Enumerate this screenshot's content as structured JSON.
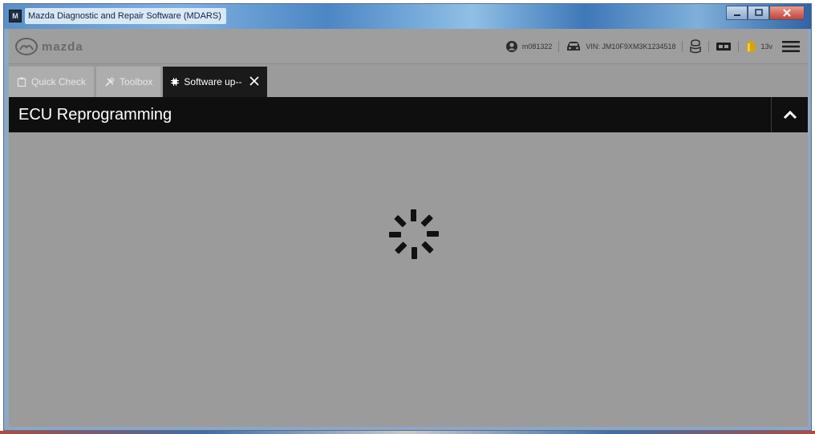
{
  "window": {
    "title": "Mazda Diagnostic and Repair Software (MDARS)",
    "app_icon_text": "M"
  },
  "header": {
    "logo_text": "mazda",
    "user_id": "m081322",
    "vin": "VIN: JM10F9XM3K1234518",
    "battery_voltage": "13v"
  },
  "tabs": [
    {
      "label": "Quick Check",
      "icon": "clipboard-icon",
      "active": false
    },
    {
      "label": "Toolbox",
      "icon": "tools-icon",
      "active": false
    },
    {
      "label": "Software up--",
      "icon": "chip-icon",
      "active": true
    }
  ],
  "section": {
    "title": "ECU Reprogramming"
  },
  "colors": {
    "accent_dark": "#0f0f0f",
    "background": "#9b9b9b",
    "tab_inactive": "#adadad"
  }
}
